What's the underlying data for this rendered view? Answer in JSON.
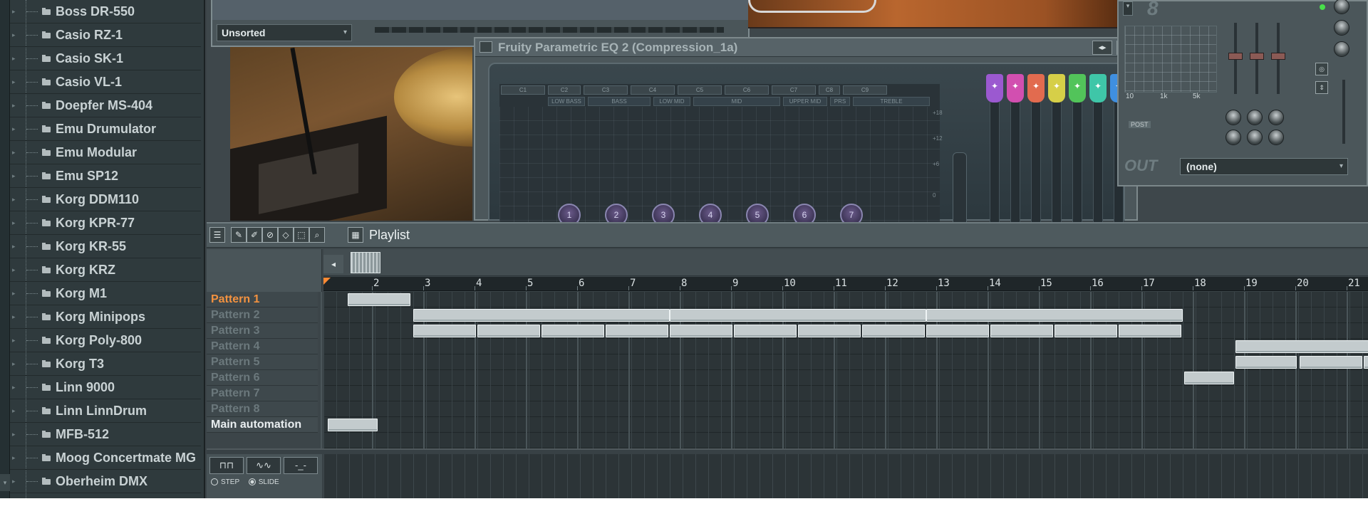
{
  "browser": {
    "items": [
      {
        "label": "Boss DR-550"
      },
      {
        "label": "Casio RZ-1"
      },
      {
        "label": "Casio SK-1"
      },
      {
        "label": "Casio VL-1"
      },
      {
        "label": "Doepfer MS-404"
      },
      {
        "label": "Emu Drumulator"
      },
      {
        "label": "Emu Modular"
      },
      {
        "label": "Emu SP12"
      },
      {
        "label": "Korg DDM110"
      },
      {
        "label": "Korg KPR-77"
      },
      {
        "label": "Korg KR-55"
      },
      {
        "label": "Korg KRZ"
      },
      {
        "label": "Korg M1"
      },
      {
        "label": "Korg Minipops"
      },
      {
        "label": "Korg Poly-800"
      },
      {
        "label": "Korg T3"
      },
      {
        "label": "Linn 9000"
      },
      {
        "label": "Linn LinnDrum"
      },
      {
        "label": "MFB-512"
      },
      {
        "label": "Moog Concertmate MG"
      },
      {
        "label": "Oberheim DMX"
      }
    ]
  },
  "top_window": {
    "sort_value": "Unsorted"
  },
  "eq_window": {
    "title": "Fruity Parametric EQ 2 (Compression_1a)",
    "bands": [
      "C1",
      "C2",
      "C3",
      "C4",
      "C5",
      "C6",
      "C7",
      "C8",
      "C9"
    ],
    "ranges": [
      "LOW BASS",
      "BASS",
      "LOW MID",
      "MID",
      "UPPER MID",
      "PRS",
      "TREBLE"
    ],
    "db_labels": [
      "+18",
      "+12",
      "+6",
      "0"
    ],
    "knobs": [
      "1",
      "2",
      "3",
      "4",
      "5",
      "6",
      "7"
    ],
    "handle_colors": [
      "#9b59d0",
      "#d24fb0",
      "#e26b4f",
      "#d6cf48",
      "#52c45a",
      "#3fc6a8",
      "#3f8fe0"
    ],
    "handle_symbol": "✦"
  },
  "mixer_window": {
    "big_number": "8",
    "freq_labels": [
      "10",
      "1k",
      "5k"
    ],
    "post_label": "POST",
    "out_label": "OUT",
    "out_value": "(none)"
  },
  "playlist": {
    "title": "Playlist",
    "ruler": [
      "2",
      "3",
      "4",
      "5",
      "6",
      "7",
      "8",
      "9",
      "10",
      "11",
      "12",
      "13",
      "14",
      "15",
      "16",
      "17",
      "18",
      "19",
      "20",
      "21"
    ],
    "tracks": [
      {
        "name": "Pattern 1"
      },
      {
        "name": "Pattern 2"
      },
      {
        "name": "Pattern 3"
      },
      {
        "name": "Pattern 4"
      },
      {
        "name": "Pattern 5"
      },
      {
        "name": "Pattern 6"
      },
      {
        "name": "Pattern 7"
      },
      {
        "name": "Pattern 8"
      },
      {
        "name": "Main automation"
      }
    ],
    "automation": {
      "step_label": "STEP",
      "slide_label": "SLIDE"
    }
  },
  "colors": {
    "accent": "#f39240",
    "clip": "#c3cbcd",
    "led": "#48e04a"
  }
}
